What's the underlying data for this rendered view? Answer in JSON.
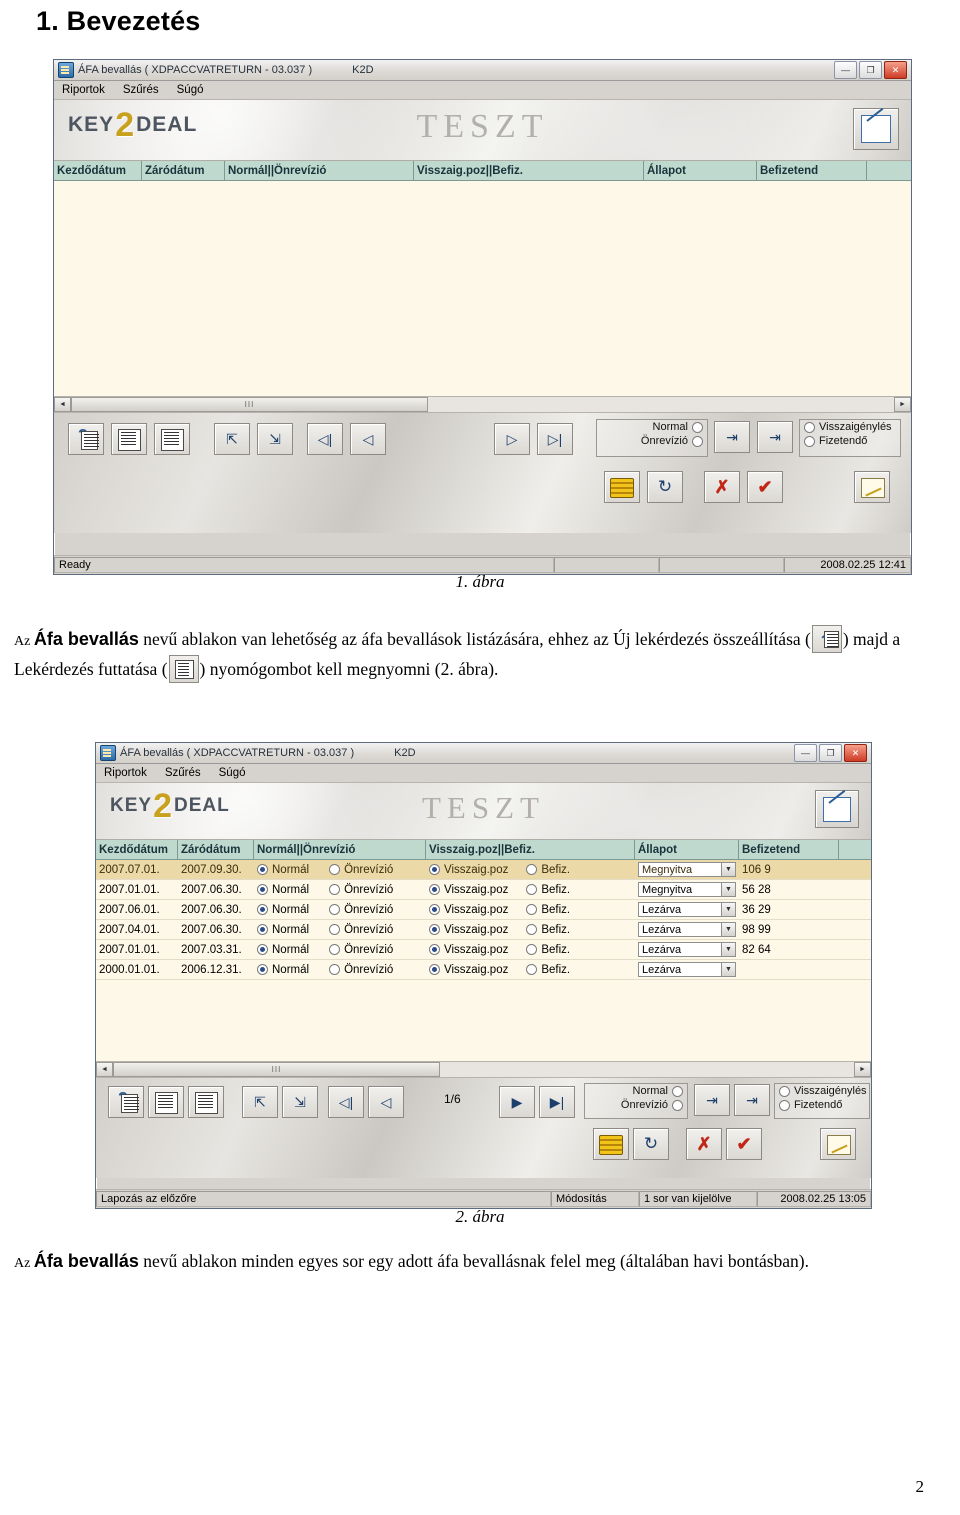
{
  "document": {
    "title": "1. Bevezetés",
    "page_number": "2"
  },
  "figure1": {
    "caption": "1. ábra",
    "window": {
      "title": "ÁFA bevallás ( XDPACCVATRETURN - 03.037 )",
      "subtitle": "K2D",
      "buttons": {
        "minimize": "—",
        "maximize": "❐",
        "close": "✕"
      },
      "menu": [
        "Riportok",
        "Szűrés",
        "Súgó"
      ],
      "banner": {
        "logo_key": "KEY",
        "logo_two": "2",
        "logo_deal": "DEAL",
        "watermark": "TESZT"
      },
      "grid_headers": [
        "Kezdődátum",
        "Záródátum",
        "Normál||Önrevízió",
        "Visszaig.poz||Befiz.",
        "Állapot",
        "Befizetend"
      ],
      "rows": [],
      "scroll_thumb": "III",
      "toolbar": {
        "option_normal": "Normal",
        "option_onrevizio": "Önrevízió",
        "option_visszaigenyles": "Visszaigénylés",
        "option_fizetendo": "Fizetendő",
        "page_indicator": ""
      },
      "status": {
        "left": "Ready",
        "middle": "",
        "right": "",
        "datetime": "2008.02.25 12:41"
      }
    }
  },
  "paragraph1": {
    "prefix": "Az ",
    "bold1": "Áfa bevallás",
    "mid1": " nevű ablakon van lehetőség az áfa bevallások listázására, ehhez az Új lekérdezés összeállítása (",
    "mid2": ") majd a Lekérdezés futtatása (",
    "suffix": ") nyomógombot kell megnyomni (2. ábra)."
  },
  "figure2": {
    "caption": "2. ábra",
    "window": {
      "title": "ÁFA bevallás ( XDPACCVATRETURN - 03.037 )",
      "subtitle": "K2D",
      "buttons": {
        "minimize": "—",
        "maximize": "❐",
        "close": "✕"
      },
      "menu": [
        "Riportok",
        "Szűrés",
        "Súgó"
      ],
      "banner": {
        "logo_key": "KEY",
        "logo_two": "2",
        "logo_deal": "DEAL",
        "watermark": "TESZT"
      },
      "grid_headers": [
        "Kezdődátum",
        "Záródátum",
        "Normál||Önrevízió",
        "Visszaig.poz||Befiz.",
        "Állapot",
        "Befizetend"
      ],
      "rows": [
        {
          "kezdodatum": "2007.07.01.",
          "zarodatum": "2007.09.30.",
          "normal": "Normál",
          "onrevizio": "Önrevízió",
          "normal_selected": true,
          "visszaig": "Visszaig.poz",
          "befiz": "Befiz.",
          "visszaig_selected": true,
          "allapot": "Megnyitva",
          "befizetendo": "106 9",
          "selected": true
        },
        {
          "kezdodatum": "2007.01.01.",
          "zarodatum": "2007.06.30.",
          "normal": "Normál",
          "onrevizio": "Önrevízió",
          "normal_selected": true,
          "visszaig": "Visszaig.poz",
          "befiz": "Befiz.",
          "visszaig_selected": true,
          "allapot": "Megnyitva",
          "befizetendo": "56 28",
          "selected": false
        },
        {
          "kezdodatum": "2007.06.01.",
          "zarodatum": "2007.06.30.",
          "normal": "Normál",
          "onrevizio": "Önrevízió",
          "normal_selected": true,
          "visszaig": "Visszaig.poz",
          "befiz": "Befiz.",
          "visszaig_selected": true,
          "allapot": "Lezárva",
          "befizetendo": "36 29",
          "selected": false
        },
        {
          "kezdodatum": "2007.04.01.",
          "zarodatum": "2007.06.30.",
          "normal": "Normál",
          "onrevizio": "Önrevízió",
          "normal_selected": true,
          "visszaig": "Visszaig.poz",
          "befiz": "Befiz.",
          "visszaig_selected": true,
          "allapot": "Lezárva",
          "befizetendo": "98 99",
          "selected": false
        },
        {
          "kezdodatum": "2007.01.01.",
          "zarodatum": "2007.03.31.",
          "normal": "Normál",
          "onrevizio": "Önrevízió",
          "normal_selected": true,
          "visszaig": "Visszaig.poz",
          "befiz": "Befiz.",
          "visszaig_selected": true,
          "allapot": "Lezárva",
          "befizetendo": "82 64",
          "selected": false
        },
        {
          "kezdodatum": "2000.01.01.",
          "zarodatum": "2006.12.31.",
          "normal": "Normál",
          "onrevizio": "Önrevízió",
          "normal_selected": true,
          "visszaig": "Visszaig.poz",
          "befiz": "Befiz.",
          "visszaig_selected": true,
          "allapot": "Lezárva",
          "befizetendo": "",
          "selected": false
        }
      ],
      "scroll_thumb": "III",
      "toolbar": {
        "option_normal": "Normal",
        "option_onrevizio": "Önrevízió",
        "option_visszaigenyles": "Visszaigénylés",
        "option_fizetendo": "Fizetendő",
        "page_indicator": "1/6"
      },
      "status": {
        "left": "Lapozás az előzőre",
        "middle": "Módosítás",
        "right": "1 sor van kijelölve",
        "datetime": "2008.02.25 13:05"
      }
    }
  },
  "paragraph2": {
    "prefix": "Az ",
    "bold1": "Áfa bevallás",
    "rest": " nevű ablakon minden egyes sor egy adott áfa bevallásnak felel meg (általában havi bontásban)."
  }
}
